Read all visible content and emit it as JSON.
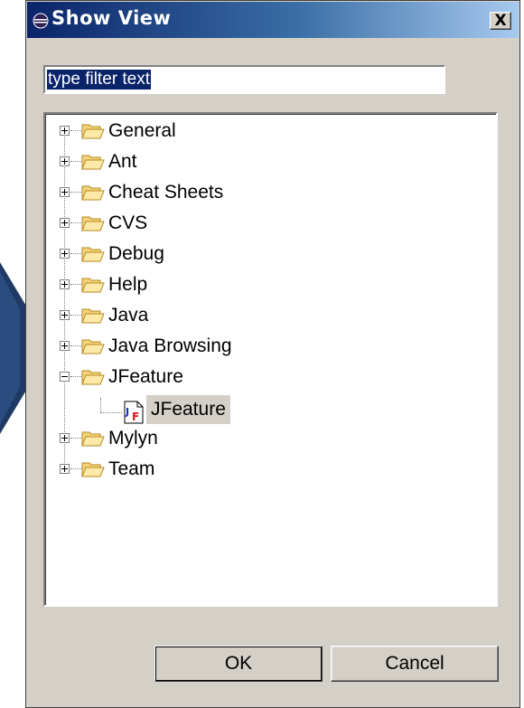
{
  "window": {
    "title": "Show View",
    "close_label": "X"
  },
  "filter": {
    "value": "type filter text"
  },
  "tree": {
    "folders": [
      {
        "label": "General",
        "expanded": false
      },
      {
        "label": "Ant",
        "expanded": false
      },
      {
        "label": "Cheat Sheets",
        "expanded": false
      },
      {
        "label": "CVS",
        "expanded": false
      },
      {
        "label": "Debug",
        "expanded": false
      },
      {
        "label": "Help",
        "expanded": false
      },
      {
        "label": "Java",
        "expanded": false
      },
      {
        "label": "Java Browsing",
        "expanded": false
      },
      {
        "label": "JFeature",
        "expanded": true
      },
      {
        "label": "Mylyn",
        "expanded": false
      },
      {
        "label": "Team",
        "expanded": false
      }
    ],
    "selected_child": {
      "label": "JFeature",
      "icon": "jfeature-view-icon"
    }
  },
  "buttons": {
    "ok": "OK",
    "cancel": "Cancel"
  },
  "colors": {
    "title_start": "#0a246a",
    "title_end": "#a6caf0",
    "dialog_bg": "#d4d0c8",
    "selection": "#0a246a"
  }
}
